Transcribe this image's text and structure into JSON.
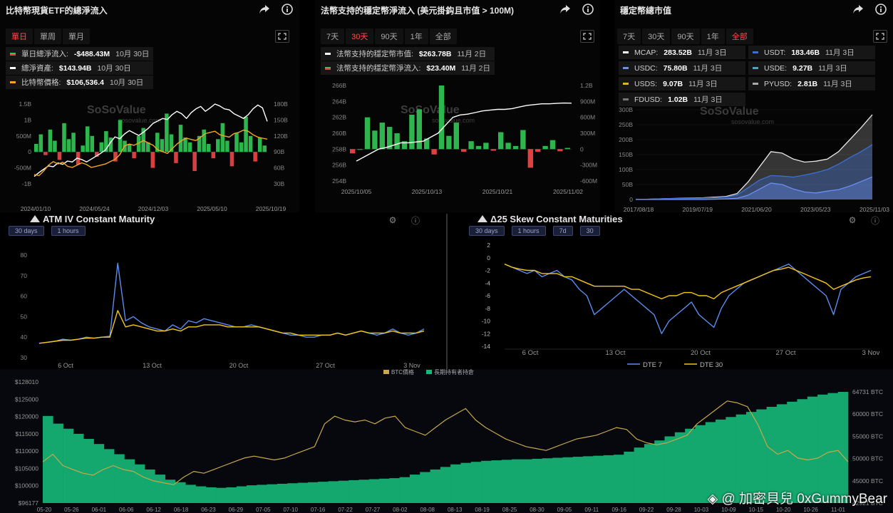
{
  "panel1": {
    "title": "比特幣現貨ETF的總淨流入",
    "tabs": [
      {
        "label": "單日",
        "active": true
      },
      {
        "label": "單周",
        "active": false
      },
      {
        "label": "單月",
        "active": false
      }
    ],
    "stats": [
      {
        "label": "單日總淨流入:",
        "value": "-$488.43M",
        "date": "10月 30日",
        "color": "#3fbf5b"
      },
      {
        "label": "總淨資產:",
        "value": "$143.94B",
        "date": "10月 30日",
        "color": "#ffffff"
      },
      {
        "label": "比特幣價格:",
        "value": "$106,536.4",
        "date": "10月 30日",
        "color": "#f5a623"
      }
    ],
    "watermark": "SoSoValue",
    "watermark_url": "sosovalue.com",
    "chart_data": {
      "type": "bar",
      "left_ticks": [
        "1.5B",
        "1B",
        "500M",
        "0",
        "-500M",
        "-1B"
      ],
      "right_ticks": [
        "180B",
        "150B",
        "120B",
        "90B",
        "60B",
        "30B"
      ],
      "x_ticks": [
        "2024/01/10",
        "2024/05/24",
        "2024/12/03",
        "2025/05/10",
        "2025/10/19"
      ],
      "flow_values": [
        0.25,
        0.55,
        -0.1,
        0.7,
        0.35,
        -0.25,
        0.9,
        0.4,
        0.6,
        -0.4,
        0.2,
        0.8,
        0.5,
        -0.15,
        0.3,
        0.65,
        0.45,
        -0.3,
        1.0,
        0.35,
        0.25,
        -0.2,
        0.5,
        0.75,
        0.3,
        -0.5,
        0.6,
        0.4,
        1.2,
        0.55,
        -0.35,
        0.85,
        0.45,
        0.3,
        -0.6,
        0.5,
        0.7,
        0.25,
        -0.2,
        0.4,
        0.9,
        0.35,
        -0.45,
        0.6,
        0.3,
        1.1,
        0.5,
        -0.3,
        0.45,
        0.2
      ],
      "net_assets_B": [
        30,
        38,
        45,
        52,
        50,
        58,
        55,
        62,
        60,
        68,
        65,
        60,
        66,
        72,
        78,
        85,
        100,
        112,
        108,
        118,
        125,
        120,
        115,
        122,
        130,
        140,
        145,
        150,
        148,
        158,
        165,
        160,
        150,
        162,
        170,
        175,
        165,
        172,
        180,
        176,
        170,
        168,
        160,
        155,
        150,
        158,
        170,
        178,
        172,
        144
      ],
      "btc_price": [
        46,
        44,
        52,
        62,
        68,
        64,
        67,
        60,
        58,
        62,
        66,
        63,
        58,
        60,
        62,
        64,
        68,
        72,
        80,
        95,
        98,
        96,
        100,
        104,
        100,
        96,
        88,
        85,
        82,
        90,
        98,
        104,
        108,
        106,
        104,
        110,
        116,
        118,
        120,
        114,
        112,
        110,
        116,
        118,
        122,
        120,
        114,
        110,
        108,
        106.5
      ]
    }
  },
  "panel2": {
    "title": "法幣支持的穩定幣淨流入 (美元掛鈎且市值 > 100M)",
    "tabs": [
      {
        "label": "7天",
        "active": false
      },
      {
        "label": "30天",
        "active": true
      },
      {
        "label": "90天",
        "active": false
      },
      {
        "label": "1年",
        "active": false
      },
      {
        "label": "全部",
        "active": false
      }
    ],
    "stats": [
      {
        "label": "法幣支持的穩定幣市值:",
        "value": "$263.78B",
        "date": "11月 2日",
        "color": "#ffffff"
      },
      {
        "label": "法幣支持的穩定幣淨流入:",
        "value": "$23.40M",
        "date": "11月 2日",
        "color": "#3fbf5b"
      }
    ],
    "watermark": "SoSoValue",
    "watermark_url": "sosovalue.com",
    "chart_data": {
      "type": "bar",
      "left_ticks": [
        "266B",
        "264B",
        "262B",
        "260B",
        "258B",
        "256B",
        "254B"
      ],
      "right_ticks": [
        "1.2B",
        "900M",
        "600M",
        "300M",
        "0",
        "-300M",
        "-600M"
      ],
      "x_ticks": [
        "2025/10/05",
        "2025/10/13",
        "2025/10/21",
        "2025/11/02"
      ],
      "flow_M": [
        -80,
        0,
        600,
        350,
        500,
        420,
        300,
        150,
        650,
        750,
        200,
        -100,
        1200,
        250,
        500,
        -50,
        150,
        60,
        120,
        -30,
        320,
        120,
        60,
        360,
        -350,
        -50,
        60,
        170,
        -40,
        23.4
      ],
      "market_cap_B": [
        256.5,
        257,
        257.5,
        258,
        258.2,
        258.5,
        258.8,
        258.8,
        258.9,
        259,
        259.5,
        260,
        261,
        262,
        262.3,
        262.4,
        262.6,
        262.8,
        262.9,
        263,
        263,
        263.1,
        263.3,
        263.5,
        263.6,
        263.7,
        263.7,
        263.75,
        263.8,
        263.78
      ]
    }
  },
  "panel3": {
    "title": "穩定幣總市值",
    "tabs": [
      {
        "label": "7天",
        "active": false
      },
      {
        "label": "30天",
        "active": false
      },
      {
        "label": "90天",
        "active": false
      },
      {
        "label": "1年",
        "active": false
      },
      {
        "label": "全部",
        "active": true
      }
    ],
    "stats": [
      {
        "label": "MCAP:",
        "value": "283.52B",
        "date": "11月 3日",
        "color": "#ffffff"
      },
      {
        "label": "USDT:",
        "value": "183.46B",
        "date": "11月 3日",
        "color": "#3b6fd6"
      },
      {
        "label": "USDC:",
        "value": "75.80B",
        "date": "11月 3日",
        "color": "#6a8ff0"
      },
      {
        "label": "USDE:",
        "value": "9.27B",
        "date": "11月 3日",
        "color": "#4aa3c8"
      },
      {
        "label": "USDS:",
        "value": "9.07B",
        "date": "11月 3日",
        "color": "#e0b030"
      },
      {
        "label": "PYUSD:",
        "value": "2.81B",
        "date": "11月 3日",
        "color": "#aaaaaa"
      },
      {
        "label": "FDUSD:",
        "value": "1.02B",
        "date": "11月 3日",
        "color": "#777777"
      }
    ],
    "watermark": "SoSoValue",
    "watermark_url": "sosovalue.com",
    "chart_data": {
      "type": "area",
      "y_ticks": [
        "300B",
        "250B",
        "200B",
        "150B",
        "100B",
        "50B",
        "0"
      ],
      "x_ticks": [
        "2017/08/18",
        "2019/07/19",
        "2021/06/20",
        "2023/05/23",
        "2025/11/03"
      ],
      "mcap_B": [
        1,
        1,
        2,
        3,
        4,
        5,
        6,
        8,
        10,
        20,
        60,
        110,
        160,
        155,
        135,
        125,
        128,
        135,
        160,
        200,
        240,
        283.5
      ],
      "usdt_B": [
        1,
        1,
        2,
        3,
        3,
        4,
        5,
        6,
        8,
        15,
        40,
        65,
        80,
        78,
        75,
        82,
        90,
        100,
        118,
        140,
        160,
        183.5
      ],
      "usdc_B": [
        0,
        0,
        0,
        0,
        0,
        0,
        0,
        1,
        2,
        4,
        15,
        35,
        55,
        50,
        35,
        25,
        22,
        28,
        33,
        45,
        60,
        75.8
      ]
    }
  },
  "panel4": {
    "title": "ATM IV Constant Maturity",
    "buttons": [
      "30 days",
      "1 hours"
    ],
    "chart_data": {
      "type": "line",
      "y_ticks": [
        "80",
        "70",
        "60",
        "50",
        "40",
        "30"
      ],
      "x_ticks": [
        "6 Oct",
        "13 Oct",
        "20 Oct",
        "27 Oct",
        "3 Nov"
      ],
      "series_blue": [
        37,
        37.5,
        38,
        39,
        38.5,
        39,
        40,
        39.5,
        40,
        40.5,
        76,
        48,
        50,
        47,
        45,
        44,
        43,
        46,
        44,
        48,
        47,
        49,
        48,
        47,
        46,
        45,
        45,
        46,
        45,
        44,
        43,
        42,
        41,
        41,
        40,
        40,
        41,
        41,
        42,
        41,
        42,
        43,
        42,
        41,
        42,
        44,
        42,
        41,
        42,
        44
      ],
      "series_yellow": [
        37,
        37.5,
        38,
        38.5,
        38.5,
        39,
        39.5,
        39.5,
        40,
        40,
        53,
        45,
        46,
        45,
        44,
        43,
        43,
        44,
        43,
        45,
        45,
        46,
        46,
        46,
        45,
        45,
        45,
        45,
        45,
        44,
        43,
        42,
        42,
        41,
        41,
        41,
        41,
        41,
        42,
        41,
        42,
        43,
        42,
        42,
        42,
        43,
        42,
        42,
        42,
        43
      ]
    }
  },
  "panel5": {
    "title": "Δ25 Skew Constant Maturities",
    "buttons": [
      "30 days",
      "1 hours",
      "7d",
      "30"
    ],
    "legend": [
      {
        "label": "DTE 7",
        "color": "#5b8def"
      },
      {
        "label": "DTE 30",
        "color": "#f5c518"
      }
    ],
    "chart_data": {
      "type": "line",
      "y_ticks": [
        "2",
        "0",
        "-2",
        "-4",
        "-6",
        "-8",
        "-10",
        "-12",
        "-14"
      ],
      "x_ticks": [
        "6 Oct",
        "13 Oct",
        "20 Oct",
        "27 Oct",
        "3 Nov"
      ],
      "series_blue": [
        -1,
        -1.5,
        -2,
        -2.5,
        -2,
        -3,
        -2.5,
        -2,
        -3,
        -3.5,
        -5,
        -6,
        -9,
        -8,
        -7,
        -6,
        -5,
        -6,
        -7,
        -8,
        -9,
        -12,
        -10,
        -9,
        -8,
        -7,
        -9,
        -10,
        -11,
        -8,
        -6,
        -5,
        -4,
        -3.5,
        -3,
        -2.5,
        -2,
        -1.5,
        -1,
        -2,
        -3,
        -4,
        -5,
        -6,
        -9,
        -5,
        -4,
        -3,
        -2.5,
        -2
      ],
      "series_yellow": [
        -1,
        -1.5,
        -1.8,
        -2,
        -2,
        -2.5,
        -2.5,
        -2.5,
        -3,
        -3,
        -3.5,
        -4,
        -4.5,
        -4.5,
        -4.5,
        -4.5,
        -4.5,
        -5,
        -5,
        -5.5,
        -6,
        -6.5,
        -6,
        -6,
        -5.5,
        -5.5,
        -6,
        -6,
        -6.5,
        -5.5,
        -5,
        -4.5,
        -4,
        -3.5,
        -3,
        -2.5,
        -2,
        -1.8,
        -1.5,
        -2,
        -2.5,
        -3,
        -3.5,
        -4,
        -5,
        -4.5,
        -4,
        -3.5,
        -3.2,
        -3
      ]
    }
  },
  "panel6": {
    "legend": [
      {
        "label": "BTC價格",
        "color": "#c8a84a"
      },
      {
        "label": "長期持有者持倉",
        "color": "#16b87a"
      }
    ],
    "chart_data": {
      "type": "bar",
      "left_ticks": [
        "$128010",
        "$125000",
        "$120000",
        "$115000",
        "$110000",
        "$105000",
        "$100000",
        "$96177"
      ],
      "right_ticks": [
        "64731 BTC",
        "60000 BTC",
        "55000 BTC",
        "50000 BTC",
        "45000 BTC",
        "42921 BTC"
      ],
      "x_ticks": [
        "05-20",
        "05-26",
        "06-01",
        "06-06",
        "06-12",
        "06-18",
        "06-23",
        "06-29",
        "07-05",
        "07-10",
        "07-16",
        "07-22",
        "07-27",
        "08-02",
        "08-08",
        "08-13",
        "08-19",
        "08-25",
        "08-30",
        "09-05",
        "09-11",
        "09-16",
        "09-22",
        "09-28",
        "10-03",
        "10-09",
        "10-15",
        "10-20",
        "10-26",
        "11-01"
      ],
      "holdings_BTC": [
        60000,
        58500,
        57500,
        56500,
        55500,
        54500,
        53500,
        52500,
        51500,
        50500,
        49500,
        48500,
        47500,
        47000,
        46500,
        46200,
        46000,
        45900,
        46000,
        46200,
        46400,
        46500,
        46600,
        46700,
        46800,
        46900,
        47000,
        47100,
        47200,
        47300,
        47400,
        47500,
        47600,
        47700,
        47800,
        48000,
        48500,
        49000,
        49500,
        50000,
        50500,
        50800,
        51000,
        51200,
        51300,
        51400,
        51500,
        51500,
        51600,
        51700,
        51800,
        51900,
        52000,
        52100,
        52200,
        52300,
        52400,
        53000,
        53800,
        54500,
        55200,
        56000,
        56800,
        57500,
        58200,
        58800,
        59300,
        59800,
        60300,
        60800,
        61300,
        61800,
        62300,
        62800,
        63300,
        63800,
        64200,
        64500,
        64731
      ],
      "btc_price": [
        107000,
        109000,
        106000,
        105000,
        104000,
        103500,
        105000,
        106000,
        105000,
        104500,
        103000,
        102000,
        101500,
        101000,
        103000,
        104500,
        104000,
        105000,
        106000,
        107000,
        108000,
        108500,
        108000,
        107500,
        108000,
        109000,
        110000,
        111000,
        117000,
        119000,
        118000,
        117500,
        118000,
        117000,
        118500,
        119000,
        116000,
        115000,
        114000,
        116000,
        118000,
        119500,
        121000,
        118000,
        116000,
        114500,
        113000,
        112000,
        111000,
        110500,
        110000,
        111000,
        112000,
        113000,
        113500,
        114000,
        115000,
        116000,
        115500,
        113000,
        112000,
        111500,
        112000,
        113000,
        114000,
        117000,
        119000,
        121000,
        123000,
        122500,
        121500,
        117000,
        111000,
        109000,
        110000,
        108000,
        107500,
        108000,
        109500,
        110000,
        107000
      ]
    }
  },
  "credit": "◈ @ 加密貝兒 0xGummyBear"
}
